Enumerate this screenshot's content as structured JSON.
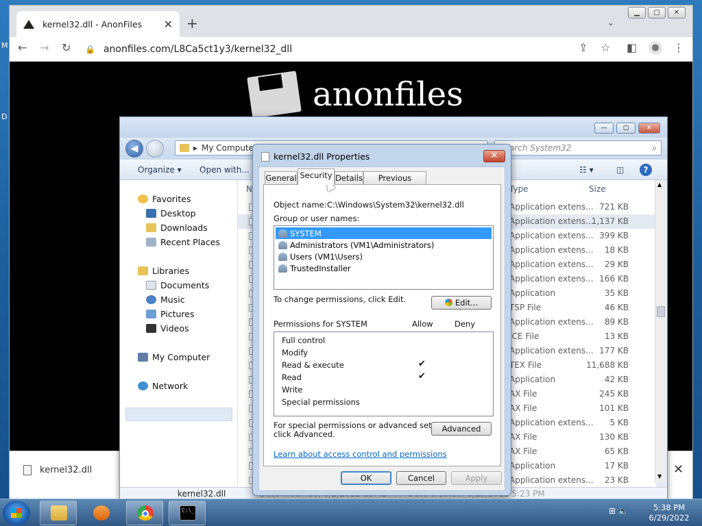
{
  "desktop": {
    "glyph_m": "M",
    "glyph_d": "D"
  },
  "chrome": {
    "tab_title": "kernel32.dll - AnonFiles",
    "tab_close": "✕",
    "new_tab": "+",
    "tab_search": "⌄",
    "minimize": "▁",
    "maximize": "▢",
    "close": "✕",
    "url": "anonfiles.com/L8Ca5ct1y3/kernel32_dll",
    "back": "←",
    "forward": "→",
    "reload": "↻",
    "lock": "🔒",
    "share": "⇪",
    "star": "☆",
    "sidepanel": "◧",
    "profile": "●",
    "menu": "⋮",
    "site_name": "anonfiles",
    "download_file": "kernel32.dll",
    "download_close": "✕"
  },
  "explorer": {
    "address": "My Computer",
    "address_sep": "▸",
    "search_placeholder": "Search System32",
    "search_icon": "⌕",
    "cmd_organize": "Organize ▾",
    "cmd_open_with": "Open with...",
    "view_icon": "☷ ▾",
    "preview_icon": "◫",
    "help_icon": "?",
    "minimize": "—",
    "maximize": "▢",
    "close": "✕",
    "back": "◀",
    "col_name": "N",
    "col_type": "Type",
    "col_size": "Size",
    "nav": {
      "favorites": "Favorites",
      "desktop": "Desktop",
      "downloads": "Downloads",
      "recent": "Recent Places",
      "libraries": "Libraries",
      "documents": "Documents",
      "music": "Music",
      "pictures": "Pictures",
      "videos": "Videos",
      "my_computer": "My Computer",
      "network": "Network"
    },
    "rows": [
      {
        "type": "Application extens...",
        "size": "721 KB"
      },
      {
        "type": "Application extens...",
        "size": "1,137 KB"
      },
      {
        "type": "Application extens...",
        "size": "399 KB"
      },
      {
        "type": "Application extens...",
        "size": "18 KB"
      },
      {
        "type": "Application extens...",
        "size": "29 KB"
      },
      {
        "type": "Application extens...",
        "size": "166 KB"
      },
      {
        "type": "Application",
        "size": "35 KB"
      },
      {
        "type": "TSP File",
        "size": "46 KB"
      },
      {
        "type": "Application extens...",
        "size": "89 KB"
      },
      {
        "type": "ICE File",
        "size": "13 KB"
      },
      {
        "type": "Application extens...",
        "size": "177 KB"
      },
      {
        "type": "TEX File",
        "size": "11,688 KB"
      },
      {
        "type": "Application",
        "size": "42 KB"
      },
      {
        "type": "AX File",
        "size": "245 KB"
      },
      {
        "type": "AX File",
        "size": "101 KB"
      },
      {
        "type": "Application extens...",
        "size": "5 KB"
      },
      {
        "type": "AX File",
        "size": "130 KB"
      },
      {
        "type": "AX File",
        "size": "65 KB"
      },
      {
        "type": "Application",
        "size": "17 KB"
      },
      {
        "type": "Application extens...",
        "size": "23 KB"
      }
    ],
    "details_name": "kernel32.dll",
    "details_modified": "Date modified: 6/2/2022 11:42 PM",
    "details_created": "Date created: 6/29/2022 5:23 PM"
  },
  "dialog": {
    "title": "kernel32.dll Properties",
    "close": "✕",
    "tabs": [
      "General",
      "Security",
      "Details",
      "Previous Versions"
    ],
    "object_label": "Object name:",
    "object_value": "C:\\Windows\\System32\\kernel32.dll",
    "group_label": "Group or user names:",
    "users": [
      "SYSTEM",
      "Administrators (VM1\\Administrators)",
      "Users (VM1\\Users)",
      "TrustedInstaller"
    ],
    "change_text": "To change permissions, click Edit.",
    "edit_button": "Edit...",
    "perm_for": "Permissions for SYSTEM",
    "allow": "Allow",
    "deny": "Deny",
    "perms": [
      "Full control",
      "Modify",
      "Read & execute",
      "Read",
      "Write",
      "Special permissions"
    ],
    "check": "✔",
    "special_text_1": "For special permissions or advanced settings,",
    "special_text_2": "click Advanced.",
    "advanced_button": "Advanced",
    "learn_link": "Learn about access control and permissions",
    "ok": "OK",
    "cancel": "Cancel",
    "apply": "Apply"
  },
  "taskbar": {
    "cmd_text": "C:\\_",
    "tray": "⊞ 🔈",
    "time": "5:38 PM",
    "date": "6/29/2022"
  }
}
